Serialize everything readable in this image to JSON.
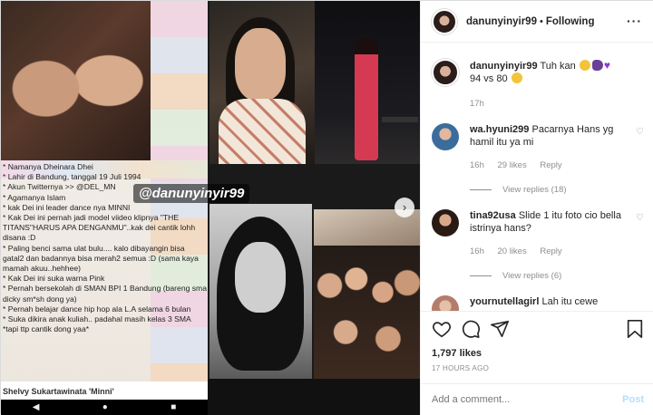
{
  "media": {
    "watermark": "@danunyinyir99",
    "caption_lines": [
      "* Namanya Dheinara Dhei",
      "* Lahir di Bandung, tanggal 19 Juli 1994",
      "* Akun Twitternya >> @DEL_MN",
      "* Agamanya Islam",
      "* kak Dei ini leader dance nya MINNI",
      "* Kak Dei ini pernah jadi model viideo klipnya \"THE TITANS\"HARUS APA DENGANMU\"..kak dei cantik lohh disana :D",
      "* Paling benci sama ulat bulu.... kalo dibayangin bisa gatal2 dan badannya bisa merah2 semua :D (sama kaya mamah akuu..hehhee)",
      "* Kak Dei ini suka warna Pink",
      "* Pernah bersekolah di SMAN BPI 1 Bandung (bareng sma dicky sm*sh dong ya)",
      "* Pernah belajar dance hip hop ala L.A selama 6 bulan",
      "* Suka dikira anak kuliah.. padahal masih kelas 3 SMA *tapi ttp cantik dong yaa*"
    ],
    "name_bar": "Shelvy Sukartawinata 'Minni'",
    "nav_next": "›"
  },
  "header": {
    "username": "danunyinyir99",
    "separator": "•",
    "follow_status": "Following",
    "menu": "···"
  },
  "caption": {
    "username": "danunyinyir99",
    "text_before": "Tuh kan",
    "text_after": "94 vs 80",
    "time": "17h"
  },
  "comments": [
    {
      "username": "wa.hyuni299",
      "text": "Pacarnya Hans yg hamil itu ya mi",
      "time": "16h",
      "likes": "29 likes",
      "reply": "Reply",
      "view_replies": "View replies (18)",
      "avatar_color": "#3a6d9c"
    },
    {
      "username": "tina92usa",
      "text": "Slide 1 itu foto cio bella istrinya hans?",
      "time": "16h",
      "likes": "20 likes",
      "reply": "Reply",
      "view_replies": "View replies (6)",
      "avatar_color": "#5a3322"
    },
    {
      "username": "yournutellagirl",
      "text": "Lah itu cewe",
      "time": "",
      "likes": "",
      "reply": "",
      "view_replies": "",
      "avatar_color": "#b47c6a"
    }
  ],
  "actions": {
    "likes": "1,797 likes",
    "posted_ago": "17 HOURS AGO"
  },
  "comment_box": {
    "placeholder": "Add a comment...",
    "post_label": "Post"
  },
  "colors": {
    "accent": "#0095f6",
    "post_disabled": "#b2dffc",
    "muted": "#8e8e8e",
    "text": "#262626"
  }
}
